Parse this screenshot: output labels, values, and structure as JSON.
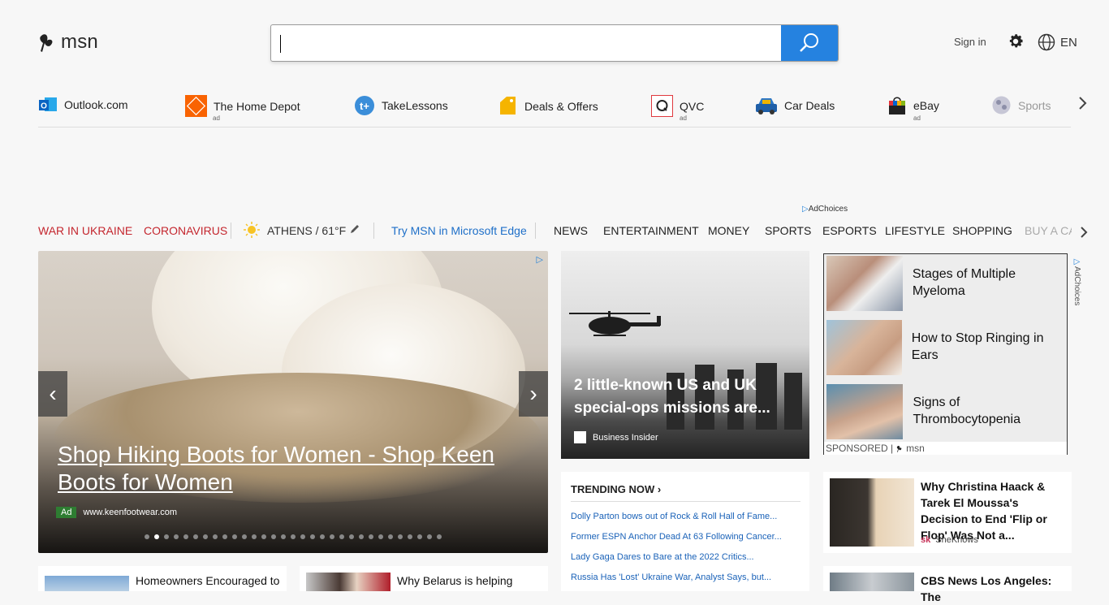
{
  "header": {
    "logo_text": "msn",
    "search_placeholder": "",
    "sign_in": "Sign in",
    "language": "EN"
  },
  "quicklinks": [
    {
      "label": "Outlook.com",
      "ad": ""
    },
    {
      "label": "The Home Depot",
      "ad": "ad"
    },
    {
      "label": "TakeLessons",
      "ad": ""
    },
    {
      "label": "Deals & Offers",
      "ad": ""
    },
    {
      "label": "QVC",
      "ad": "ad"
    },
    {
      "label": "Car Deals",
      "ad": ""
    },
    {
      "label": "eBay",
      "ad": "ad"
    },
    {
      "label": "Sports",
      "ad": ""
    }
  ],
  "adchoices_label": "AdChoices",
  "nav": {
    "alert1": "WAR IN UKRAINE",
    "alert2": "CORONAVIRUS",
    "weather": "ATHENS / 61°F",
    "edge": "Try MSN in Microsoft Edge",
    "items": [
      "NEWS",
      "ENTERTAINMENT",
      "MONEY",
      "SPORTS",
      "ESPORTS",
      "LIFESTYLE",
      "SHOPPING",
      "BUY A CA"
    ]
  },
  "hero": {
    "title": "Shop Hiking Boots for Women - Shop Keen Boots for Women",
    "badge": "Ad",
    "source": "www.keenfootwear.com",
    "dot_count": 31,
    "active_dot": 2
  },
  "mid_story": {
    "title": "2 little-known US and UK special-ops missions are...",
    "source": "Business Insider"
  },
  "sponsored": {
    "items": [
      "Stages of Multiple Myeloma",
      "How to Stop Ringing in Ears",
      "Signs of Thrombocytopenia"
    ],
    "footer": "SPONSORED |",
    "footer_brand": "msn"
  },
  "trending": {
    "heading": "TRENDING NOW",
    "items": [
      "Dolly Parton bows out of Rock & Roll Hall of Fame...",
      "Former ESPN Anchor Dead At 63 Following Cancer...",
      "Lady Gaga Dares to Bare at the 2022 Critics...",
      "Russia Has 'Lost' Ukraine War, Analyst Says, but..."
    ]
  },
  "right_story": {
    "title": "Why Christina Haack & Tarek El Moussa's Decision to End 'Flip or Flop' Was Not a...",
    "source": "SheKnows"
  },
  "bottom_stories": [
    {
      "title": "Homeowners Encouraged to"
    },
    {
      "title": "Why Belarus is helping"
    },
    {
      "title": "CBS News Los Angeles: The"
    }
  ],
  "colors": {
    "accent": "#2582e0",
    "alert": "#c4262e",
    "link": "#1a62b8",
    "edge_link": "#1e6fc8"
  }
}
